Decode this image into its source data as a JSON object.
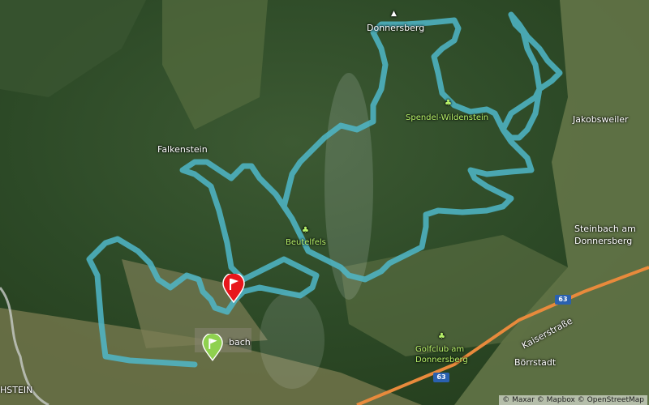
{
  "map": {
    "places": {
      "donnersberg": "Donnersberg",
      "spendel": "Spendel-Wildenstein",
      "jakobsweiler": "Jakobsweiler",
      "falkenstein": "Falkenstein",
      "steinbach_1": "Steinbach am",
      "steinbach_2": "Donnersberg",
      "beutelfels": "Beutelfels",
      "dannenfels": "bach",
      "golfclub_1": "Golfclub am",
      "golfclub_2": "Donnersberg",
      "kaiserstrasse": "Kaiserstraße",
      "boerrstadt": "Börrstadt",
      "hstein": "HSTEIN"
    },
    "road_shields": {
      "a63_top": "63",
      "a63_bottom": "63"
    },
    "attribution": "© Maxar © Mapbox © OpenStreetMap",
    "colors": {
      "route": "#4fb7c9",
      "finish": "#e8161c",
      "start": "#8fd14f",
      "highway": "#e88a3c"
    }
  }
}
